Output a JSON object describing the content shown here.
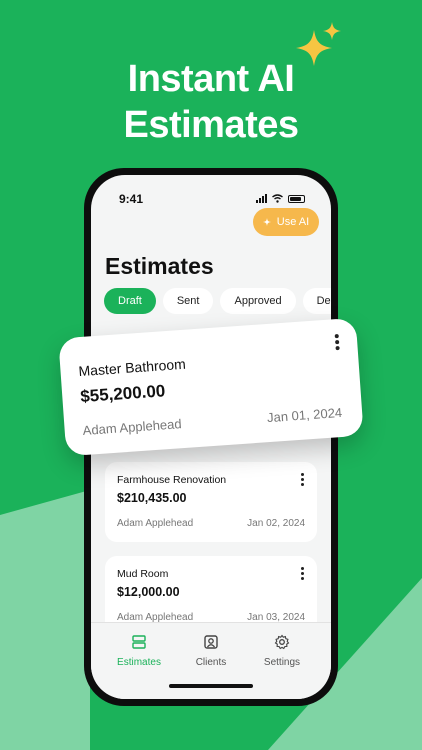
{
  "headline": [
    "Instant AI",
    "Estimates"
  ],
  "status_bar": {
    "time": "9:41"
  },
  "use_ai_label": "Use AI",
  "page_title": "Estimates",
  "filters": [
    "Draft",
    "Sent",
    "Approved",
    "Declin"
  ],
  "featured_estimate": {
    "title": "Master Bathroom",
    "amount": "$55,200.00",
    "client": "Adam Applehead",
    "date": "Jan 01, 2024"
  },
  "estimates": [
    {
      "title": "Farmhouse Renovation",
      "amount": "$210,435.00",
      "client": "Adam Applehead",
      "date": "Jan 02, 2024"
    },
    {
      "title": "Mud Room",
      "amount": "$12,000.00",
      "client": "Adam Applehead",
      "date": "Jan 03, 2024"
    }
  ],
  "tabs": [
    "Estimates",
    "Clients",
    "Settings"
  ],
  "colors": {
    "brand_green": "#1bb25a",
    "light_green": "#7fd4a4",
    "ai_orange": "#f6b84c",
    "sparkle": "#f6c542"
  }
}
